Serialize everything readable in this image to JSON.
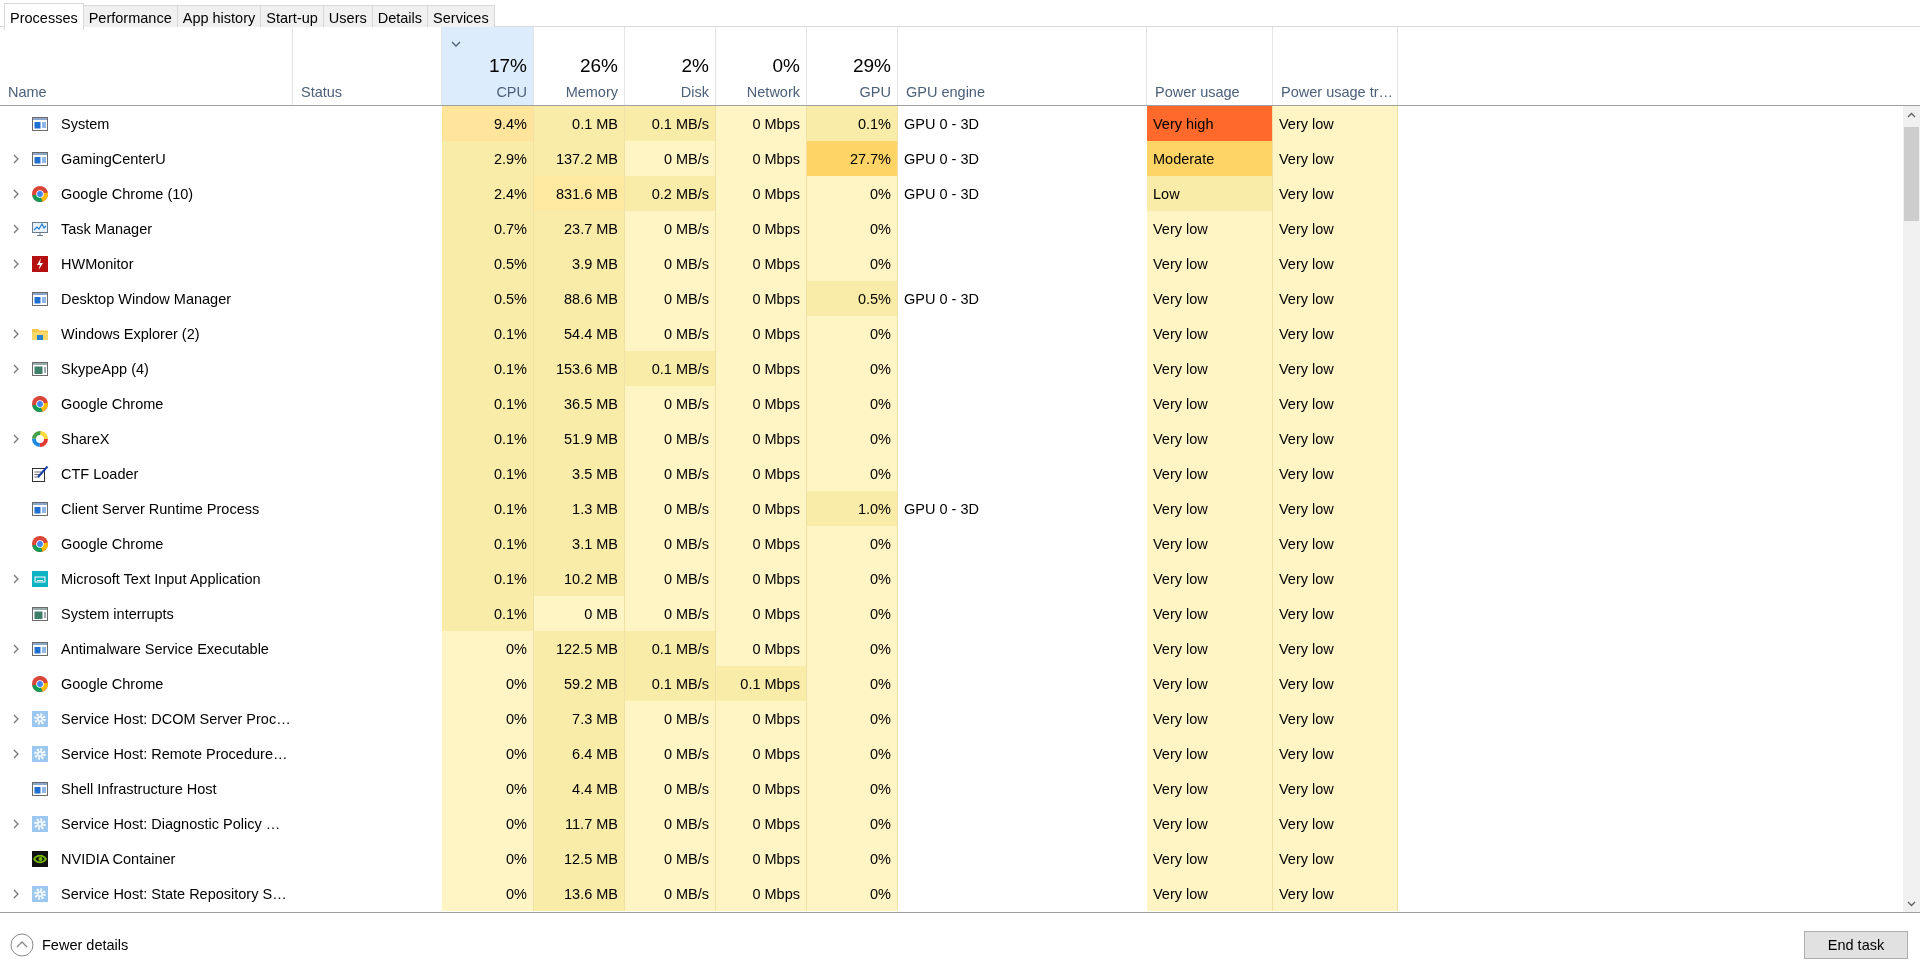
{
  "tabs": [
    {
      "label": "Processes",
      "selected": true
    },
    {
      "label": "Performance",
      "selected": false
    },
    {
      "label": "App history",
      "selected": false
    },
    {
      "label": "Start-up",
      "selected": false
    },
    {
      "label": "Users",
      "selected": false
    },
    {
      "label": "Details",
      "selected": false
    },
    {
      "label": "Services",
      "selected": false
    }
  ],
  "columns": [
    {
      "label": "Name",
      "sorted": false
    },
    {
      "label": "Status",
      "sorted": false
    },
    {
      "label": "CPU",
      "total": "17%",
      "sorted": true
    },
    {
      "label": "Memory",
      "total": "26%",
      "sorted": false
    },
    {
      "label": "Disk",
      "total": "2%",
      "sorted": false
    },
    {
      "label": "Network",
      "total": "0%",
      "sorted": false
    },
    {
      "label": "GPU",
      "total": "29%",
      "sorted": false
    },
    {
      "label": "GPU engine",
      "sorted": false
    },
    {
      "label": "Power usage",
      "sorted": false
    },
    {
      "label": "Power usage tr…",
      "sorted": false
    }
  ],
  "rows": [
    {
      "kind": "window",
      "expandable": false,
      "name": "System",
      "cells": [
        {
          "text": "9.4%",
          "color": "#ffe49b"
        },
        {
          "text": "0.1 MB",
          "color": "#f9eca8"
        },
        {
          "text": "0.1 MB/s",
          "color": "#f9eca8"
        },
        {
          "text": "0 Mbps",
          "color": "#fff4c4"
        },
        {
          "text": "0.1%",
          "color": "#f9eca8"
        }
      ],
      "gpu_engine": "GPU 0 - 3D",
      "power": {
        "text": "Very high",
        "color": "#ff6a2c"
      },
      "power_trend": {
        "text": "Very low",
        "color": "#fff4c4"
      }
    },
    {
      "kind": "window",
      "expandable": true,
      "name": "GamingCenterU",
      "cells": [
        {
          "text": "2.9%",
          "color": "#f9eca8"
        },
        {
          "text": "137.2 MB",
          "color": "#f9eca8"
        },
        {
          "text": "0 MB/s",
          "color": "#fff4c4"
        },
        {
          "text": "0 Mbps",
          "color": "#fff4c4"
        },
        {
          "text": "27.7%",
          "color": "#ffd466"
        }
      ],
      "gpu_engine": "GPU 0 - 3D",
      "power": {
        "text": "Moderate",
        "color": "#ffd466"
      },
      "power_trend": {
        "text": "Very low",
        "color": "#fff4c4"
      }
    },
    {
      "kind": "chrome",
      "expandable": true,
      "name": "Google Chrome (10)",
      "cells": [
        {
          "text": "2.4%",
          "color": "#f9eca8"
        },
        {
          "text": "831.6 MB",
          "color": "#ffe9a0"
        },
        {
          "text": "0.2 MB/s",
          "color": "#f9eca8"
        },
        {
          "text": "0 Mbps",
          "color": "#fff4c4"
        },
        {
          "text": "0%",
          "color": "#fff4c4"
        }
      ],
      "gpu_engine": "GPU 0 - 3D",
      "power": {
        "text": "Low",
        "color": "#f9eca8"
      },
      "power_trend": {
        "text": "Very low",
        "color": "#fff4c4"
      }
    },
    {
      "kind": "taskmgr",
      "expandable": true,
      "name": "Task Manager",
      "cells": [
        {
          "text": "0.7%",
          "color": "#f9eca8"
        },
        {
          "text": "23.7 MB",
          "color": "#f9eca8"
        },
        {
          "text": "0 MB/s",
          "color": "#fff4c4"
        },
        {
          "text": "0 Mbps",
          "color": "#fff4c4"
        },
        {
          "text": "0%",
          "color": "#fff4c4"
        }
      ],
      "power": {
        "text": "Very low",
        "color": "#fff4c4"
      },
      "power_trend": {
        "text": "Very low",
        "color": "#fff4c4"
      }
    },
    {
      "kind": "hwmonitor",
      "expandable": true,
      "name": "HWMonitor",
      "cells": [
        {
          "text": "0.5%",
          "color": "#f9eca8"
        },
        {
          "text": "3.9 MB",
          "color": "#f9eca8"
        },
        {
          "text": "0 MB/s",
          "color": "#fff4c4"
        },
        {
          "text": "0 Mbps",
          "color": "#fff4c4"
        },
        {
          "text": "0%",
          "color": "#fff4c4"
        }
      ],
      "power": {
        "text": "Very low",
        "color": "#fff4c4"
      },
      "power_trend": {
        "text": "Very low",
        "color": "#fff4c4"
      }
    },
    {
      "kind": "window",
      "expandable": false,
      "name": "Desktop Window Manager",
      "cells": [
        {
          "text": "0.5%",
          "color": "#f9eca8"
        },
        {
          "text": "88.6 MB",
          "color": "#f9eca8"
        },
        {
          "text": "0 MB/s",
          "color": "#fff4c4"
        },
        {
          "text": "0 Mbps",
          "color": "#fff4c4"
        },
        {
          "text": "0.5%",
          "color": "#f9eca8"
        }
      ],
      "gpu_engine": "GPU 0 - 3D",
      "power": {
        "text": "Very low",
        "color": "#fff4c4"
      },
      "power_trend": {
        "text": "Very low",
        "color": "#fff4c4"
      }
    },
    {
      "kind": "explorer",
      "expandable": true,
      "name": "Windows Explorer (2)",
      "cells": [
        {
          "text": "0.1%",
          "color": "#f9eca8"
        },
        {
          "text": "54.4 MB",
          "color": "#f9eca8"
        },
        {
          "text": "0 MB/s",
          "color": "#fff4c4"
        },
        {
          "text": "0 Mbps",
          "color": "#fff4c4"
        },
        {
          "text": "0%",
          "color": "#fff4c4"
        }
      ],
      "power": {
        "text": "Very low",
        "color": "#fff4c4"
      },
      "power_trend": {
        "text": "Very low",
        "color": "#fff4c4"
      }
    },
    {
      "kind": "app",
      "expandable": true,
      "name": "SkypeApp (4)",
      "cells": [
        {
          "text": "0.1%",
          "color": "#f9eca8"
        },
        {
          "text": "153.6 MB",
          "color": "#f9eca8"
        },
        {
          "text": "0.1 MB/s",
          "color": "#f9eca8"
        },
        {
          "text": "0 Mbps",
          "color": "#fff4c4"
        },
        {
          "text": "0%",
          "color": "#fff4c4"
        }
      ],
      "power": {
        "text": "Very low",
        "color": "#fff4c4"
      },
      "power_trend": {
        "text": "Very low",
        "color": "#fff4c4"
      }
    },
    {
      "kind": "chrome",
      "expandable": false,
      "name": "Google Chrome",
      "cells": [
        {
          "text": "0.1%",
          "color": "#f9eca8"
        },
        {
          "text": "36.5 MB",
          "color": "#f9eca8"
        },
        {
          "text": "0 MB/s",
          "color": "#fff4c4"
        },
        {
          "text": "0 Mbps",
          "color": "#fff4c4"
        },
        {
          "text": "0%",
          "color": "#fff4c4"
        }
      ],
      "power": {
        "text": "Very low",
        "color": "#fff4c4"
      },
      "power_trend": {
        "text": "Very low",
        "color": "#fff4c4"
      }
    },
    {
      "kind": "sharex",
      "expandable": true,
      "name": "ShareX",
      "cells": [
        {
          "text": "0.1%",
          "color": "#f9eca8"
        },
        {
          "text": "51.9 MB",
          "color": "#f9eca8"
        },
        {
          "text": "0 MB/s",
          "color": "#fff4c4"
        },
        {
          "text": "0 Mbps",
          "color": "#fff4c4"
        },
        {
          "text": "0%",
          "color": "#fff4c4"
        }
      ],
      "power": {
        "text": "Very low",
        "color": "#fff4c4"
      },
      "power_trend": {
        "text": "Very low",
        "color": "#fff4c4"
      }
    },
    {
      "kind": "ctf",
      "expandable": false,
      "name": "CTF Loader",
      "cells": [
        {
          "text": "0.1%",
          "color": "#f9eca8"
        },
        {
          "text": "3.5 MB",
          "color": "#f9eca8"
        },
        {
          "text": "0 MB/s",
          "color": "#fff4c4"
        },
        {
          "text": "0 Mbps",
          "color": "#fff4c4"
        },
        {
          "text": "0%",
          "color": "#fff4c4"
        }
      ],
      "power": {
        "text": "Very low",
        "color": "#fff4c4"
      },
      "power_trend": {
        "text": "Very low",
        "color": "#fff4c4"
      }
    },
    {
      "kind": "window",
      "expandable": false,
      "name": "Client Server Runtime Process",
      "cells": [
        {
          "text": "0.1%",
          "color": "#f9eca8"
        },
        {
          "text": "1.3 MB",
          "color": "#f9eca8"
        },
        {
          "text": "0 MB/s",
          "color": "#fff4c4"
        },
        {
          "text": "0 Mbps",
          "color": "#fff4c4"
        },
        {
          "text": "1.0%",
          "color": "#f9eca8"
        }
      ],
      "gpu_engine": "GPU 0 - 3D",
      "power": {
        "text": "Very low",
        "color": "#fff4c4"
      },
      "power_trend": {
        "text": "Very low",
        "color": "#fff4c4"
      }
    },
    {
      "kind": "chrome",
      "expandable": false,
      "name": "Google Chrome",
      "cells": [
        {
          "text": "0.1%",
          "color": "#f9eca8"
        },
        {
          "text": "3.1 MB",
          "color": "#f9eca8"
        },
        {
          "text": "0 MB/s",
          "color": "#fff4c4"
        },
        {
          "text": "0 Mbps",
          "color": "#fff4c4"
        },
        {
          "text": "0%",
          "color": "#fff4c4"
        }
      ],
      "power": {
        "text": "Very low",
        "color": "#fff4c4"
      },
      "power_trend": {
        "text": "Very low",
        "color": "#fff4c4"
      }
    },
    {
      "kind": "keyboard",
      "expandable": true,
      "name": "Microsoft Text Input Application",
      "cells": [
        {
          "text": "0.1%",
          "color": "#f9eca8"
        },
        {
          "text": "10.2 MB",
          "color": "#f9eca8"
        },
        {
          "text": "0 MB/s",
          "color": "#fff4c4"
        },
        {
          "text": "0 Mbps",
          "color": "#fff4c4"
        },
        {
          "text": "0%",
          "color": "#fff4c4"
        }
      ],
      "power": {
        "text": "Very low",
        "color": "#fff4c4"
      },
      "power_trend": {
        "text": "Very low",
        "color": "#fff4c4"
      }
    },
    {
      "kind": "app",
      "expandable": false,
      "name": "System interrupts",
      "cells": [
        {
          "text": "0.1%",
          "color": "#f9eca8"
        },
        {
          "text": "0 MB",
          "color": "#fff4c4"
        },
        {
          "text": "0 MB/s",
          "color": "#fff4c4"
        },
        {
          "text": "0 Mbps",
          "color": "#fff4c4"
        },
        {
          "text": "0%",
          "color": "#fff4c4"
        }
      ],
      "power": {
        "text": "Very low",
        "color": "#fff4c4"
      },
      "power_trend": {
        "text": "Very low",
        "color": "#fff4c4"
      }
    },
    {
      "kind": "window",
      "expandable": true,
      "name": "Antimalware Service Executable",
      "cells": [
        {
          "text": "0%",
          "color": "#fff4c4"
        },
        {
          "text": "122.5 MB",
          "color": "#f9eca8"
        },
        {
          "text": "0.1 MB/s",
          "color": "#f9eca8"
        },
        {
          "text": "0 Mbps",
          "color": "#fff4c4"
        },
        {
          "text": "0%",
          "color": "#fff4c4"
        }
      ],
      "power": {
        "text": "Very low",
        "color": "#fff4c4"
      },
      "power_trend": {
        "text": "Very low",
        "color": "#fff4c4"
      }
    },
    {
      "kind": "chrome",
      "expandable": false,
      "name": "Google Chrome",
      "cells": [
        {
          "text": "0%",
          "color": "#fff4c4"
        },
        {
          "text": "59.2 MB",
          "color": "#f9eca8"
        },
        {
          "text": "0.1 MB/s",
          "color": "#f9eca8"
        },
        {
          "text": "0.1 Mbps",
          "color": "#f9eca8"
        },
        {
          "text": "0%",
          "color": "#fff4c4"
        }
      ],
      "power": {
        "text": "Very low",
        "color": "#fff4c4"
      },
      "power_trend": {
        "text": "Very low",
        "color": "#fff4c4"
      }
    },
    {
      "kind": "gear",
      "expandable": true,
      "name": "Service Host: DCOM Server Proc…",
      "cells": [
        {
          "text": "0%",
          "color": "#fff4c4"
        },
        {
          "text": "7.3 MB",
          "color": "#f9eca8"
        },
        {
          "text": "0 MB/s",
          "color": "#fff4c4"
        },
        {
          "text": "0 Mbps",
          "color": "#fff4c4"
        },
        {
          "text": "0%",
          "color": "#fff4c4"
        }
      ],
      "power": {
        "text": "Very low",
        "color": "#fff4c4"
      },
      "power_trend": {
        "text": "Very low",
        "color": "#fff4c4"
      }
    },
    {
      "kind": "gear",
      "expandable": true,
      "name": "Service Host: Remote Procedure…",
      "cells": [
        {
          "text": "0%",
          "color": "#fff4c4"
        },
        {
          "text": "6.4 MB",
          "color": "#f9eca8"
        },
        {
          "text": "0 MB/s",
          "color": "#fff4c4"
        },
        {
          "text": "0 Mbps",
          "color": "#fff4c4"
        },
        {
          "text": "0%",
          "color": "#fff4c4"
        }
      ],
      "power": {
        "text": "Very low",
        "color": "#fff4c4"
      },
      "power_trend": {
        "text": "Very low",
        "color": "#fff4c4"
      }
    },
    {
      "kind": "window",
      "expandable": false,
      "name": "Shell Infrastructure Host",
      "cells": [
        {
          "text": "0%",
          "color": "#fff4c4"
        },
        {
          "text": "4.4 MB",
          "color": "#f9eca8"
        },
        {
          "text": "0 MB/s",
          "color": "#fff4c4"
        },
        {
          "text": "0 Mbps",
          "color": "#fff4c4"
        },
        {
          "text": "0%",
          "color": "#fff4c4"
        }
      ],
      "power": {
        "text": "Very low",
        "color": "#fff4c4"
      },
      "power_trend": {
        "text": "Very low",
        "color": "#fff4c4"
      }
    },
    {
      "kind": "gear",
      "expandable": true,
      "name": "Service Host: Diagnostic Policy …",
      "cells": [
        {
          "text": "0%",
          "color": "#fff4c4"
        },
        {
          "text": "11.7 MB",
          "color": "#f9eca8"
        },
        {
          "text": "0 MB/s",
          "color": "#fff4c4"
        },
        {
          "text": "0 Mbps",
          "color": "#fff4c4"
        },
        {
          "text": "0%",
          "color": "#fff4c4"
        }
      ],
      "power": {
        "text": "Very low",
        "color": "#fff4c4"
      },
      "power_trend": {
        "text": "Very low",
        "color": "#fff4c4"
      }
    },
    {
      "kind": "nvidia",
      "expandable": false,
      "name": "NVIDIA Container",
      "cells": [
        {
          "text": "0%",
          "color": "#fff4c4"
        },
        {
          "text": "12.5 MB",
          "color": "#f9eca8"
        },
        {
          "text": "0 MB/s",
          "color": "#fff4c4"
        },
        {
          "text": "0 Mbps",
          "color": "#fff4c4"
        },
        {
          "text": "0%",
          "color": "#fff4c4"
        }
      ],
      "power": {
        "text": "Very low",
        "color": "#fff4c4"
      },
      "power_trend": {
        "text": "Very low",
        "color": "#fff4c4"
      }
    },
    {
      "kind": "gear",
      "expandable": true,
      "name": "Service Host: State Repository S…",
      "cells": [
        {
          "text": "0%",
          "color": "#fff4c4"
        },
        {
          "text": "13.6 MB",
          "color": "#f9eca8"
        },
        {
          "text": "0 MB/s",
          "color": "#fff4c4"
        },
        {
          "text": "0 Mbps",
          "color": "#fff4c4"
        },
        {
          "text": "0%",
          "color": "#fff4c4"
        }
      ],
      "power": {
        "text": "Very low",
        "color": "#fff4c4"
      },
      "power_trend": {
        "text": "Very low",
        "color": "#fff4c4"
      }
    }
  ],
  "footer": {
    "details_toggle": "Fewer details",
    "end_task": "End task"
  }
}
